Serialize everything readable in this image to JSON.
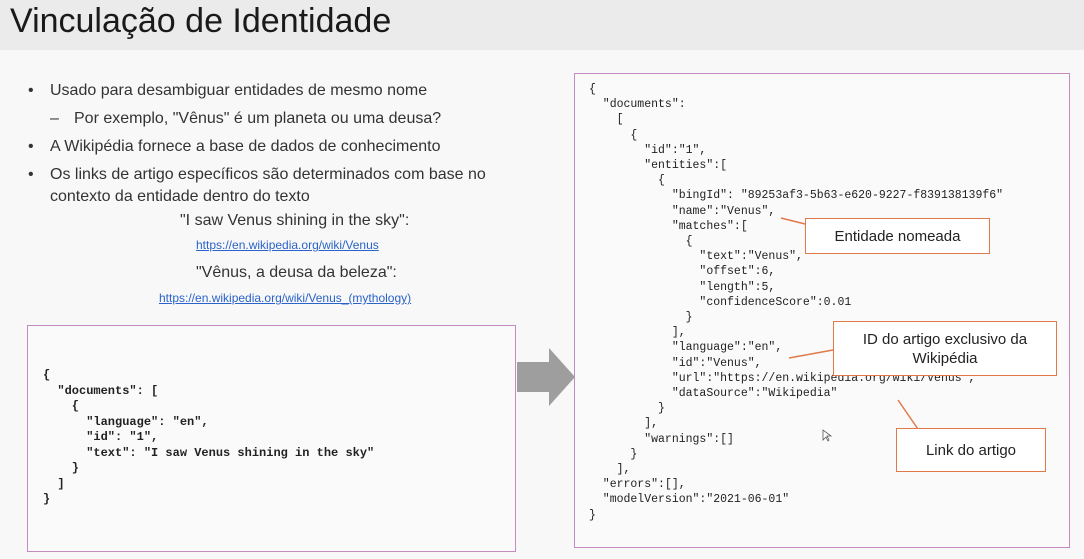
{
  "title": "Vinculação de Identidade",
  "bullets": [
    {
      "text": "Usado para desambiguar entidades de mesmo nome"
    },
    {
      "text": "Por exemplo, \"Vênus\" é um planeta ou uma deusa?",
      "sub": true
    },
    {
      "text": "A Wikipédia fornece a base de dados de conhecimento"
    },
    {
      "text": "Os links de artigo específicos são determinados com base no"
    },
    {
      "text": "contexto da entidade dentro do texto",
      "cont": true
    }
  ],
  "examples": {
    "quote1": "\"I saw Venus shining in the sky\":",
    "link1": "https://en.wikipedia.org/wiki/Venus",
    "quote2": "\"Vênus, a deusa da beleza\":",
    "link2": "https://en.wikipedia.org/wiki/Venus_(mythology)"
  },
  "request_json": "{\n  \"documents\": [\n    {\n      \"language\": \"en\",\n      \"id\": \"1\",\n      \"text\": \"I saw Venus shining in the sky\"\n    }\n  ]\n}",
  "response_json": "{\n  \"documents\":\n    [\n      {\n        \"id\":\"1\",\n        \"entities\":[\n          {\n            \"bingId\": \"89253af3-5b63-e620-9227-f839138139f6\"\n            \"name\":\"Venus\",\n            \"matches\":[\n              {\n                \"text\":\"Venus\",\n                \"offset\":6,\n                \"length\":5,\n                \"confidenceScore\":0.01\n              }\n            ],\n            \"language\":\"en\",\n            \"id\":\"Venus\",\n            \"url\":\"https://en.wikipedia.org/wiki/Venus\",\n            \"dataSource\":\"Wikipedia\"\n          }\n        ],\n        \"warnings\":[]\n      }\n    ],\n  \"errors\":[],\n  \"modelVersion\":\"2021-06-01\"\n}",
  "callouts": {
    "named_entity": "Entidade nomeada",
    "article_id": "ID do artigo exclusivo da Wikipédia",
    "article_link": "Link do artigo"
  },
  "colors": {
    "box_border": "#c48bc0",
    "callout_border": "#e07a4a",
    "link": "#2a63c9",
    "arrow": "#9e9e9e"
  }
}
